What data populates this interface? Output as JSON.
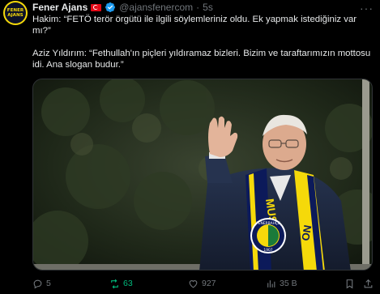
{
  "author": {
    "name": "Fener Ajans",
    "handle": "@ajansfenercom",
    "separator": "·",
    "time": "5s",
    "avatar_text_top": "FENER",
    "avatar_text_bottom": "AJANS",
    "flag_icon": "turkey-flag-icon",
    "verified_icon": "verified-badge-icon"
  },
  "more_label": "···",
  "tweet_text": {
    "line1": "Hakim: “FETÖ terör örgütü ile ilgili söylemleriniz oldu. Ek yapmak istediğiniz var",
    "line2": "mı?”",
    "line3": "Aziz Yıldırım: “Fethullah'ın piçleri yıldıramaz bizleri. Bizim ve taraftarımızın mottosu",
    "line4": "idi. Ana slogan budur.”"
  },
  "media": {
    "scarf_text_left": "MUS",
    "scarf_text_right": "ON",
    "crest_text_top": "FENERBAHÇE",
    "crest_text_bottom": "1907"
  },
  "actions": {
    "replies": "5",
    "retweets": "63",
    "likes": "927",
    "views": "35 B"
  },
  "colors": {
    "background": "#000000",
    "text": "#e7e9ea",
    "muted": "#71767b",
    "verified": "#1d9bf0",
    "retweet_active": "#00ba7c",
    "fb_yellow": "#f5d90a",
    "fb_navy": "#0c1a5a"
  }
}
